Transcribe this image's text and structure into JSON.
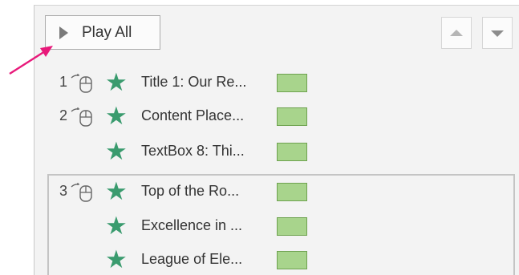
{
  "toolbar": {
    "play_all_label": "Play All",
    "play_icon": "play-triangle-icon",
    "move_up_icon": "triangle-up-icon",
    "move_down_icon": "triangle-down-icon"
  },
  "animation_list": [
    {
      "order": "1",
      "trigger_icon": "mouse-click-icon",
      "effect_icon": "green-star-icon",
      "label": "Title 1: Our Re..."
    },
    {
      "order": "2",
      "trigger_icon": "mouse-click-icon",
      "effect_icon": "green-star-icon",
      "label": "Content Place..."
    },
    {
      "order": "",
      "trigger_icon": "",
      "effect_icon": "green-star-icon",
      "label": "TextBox 8: Thi..."
    },
    {
      "order": "3",
      "trigger_icon": "mouse-click-icon",
      "effect_icon": "green-star-icon",
      "label": "Top of the Ro..."
    },
    {
      "order": "",
      "trigger_icon": "",
      "effect_icon": "green-star-icon",
      "label": "Excellence in ..."
    },
    {
      "order": "",
      "trigger_icon": "",
      "effect_icon": "green-star-icon",
      "label": "League of Ele..."
    }
  ],
  "colors": {
    "effect_star": "#3a9b6e",
    "timing_bar_fill": "#a8d48c",
    "timing_bar_border": "#6ea24f",
    "callout_arrow": "#e8197a"
  }
}
